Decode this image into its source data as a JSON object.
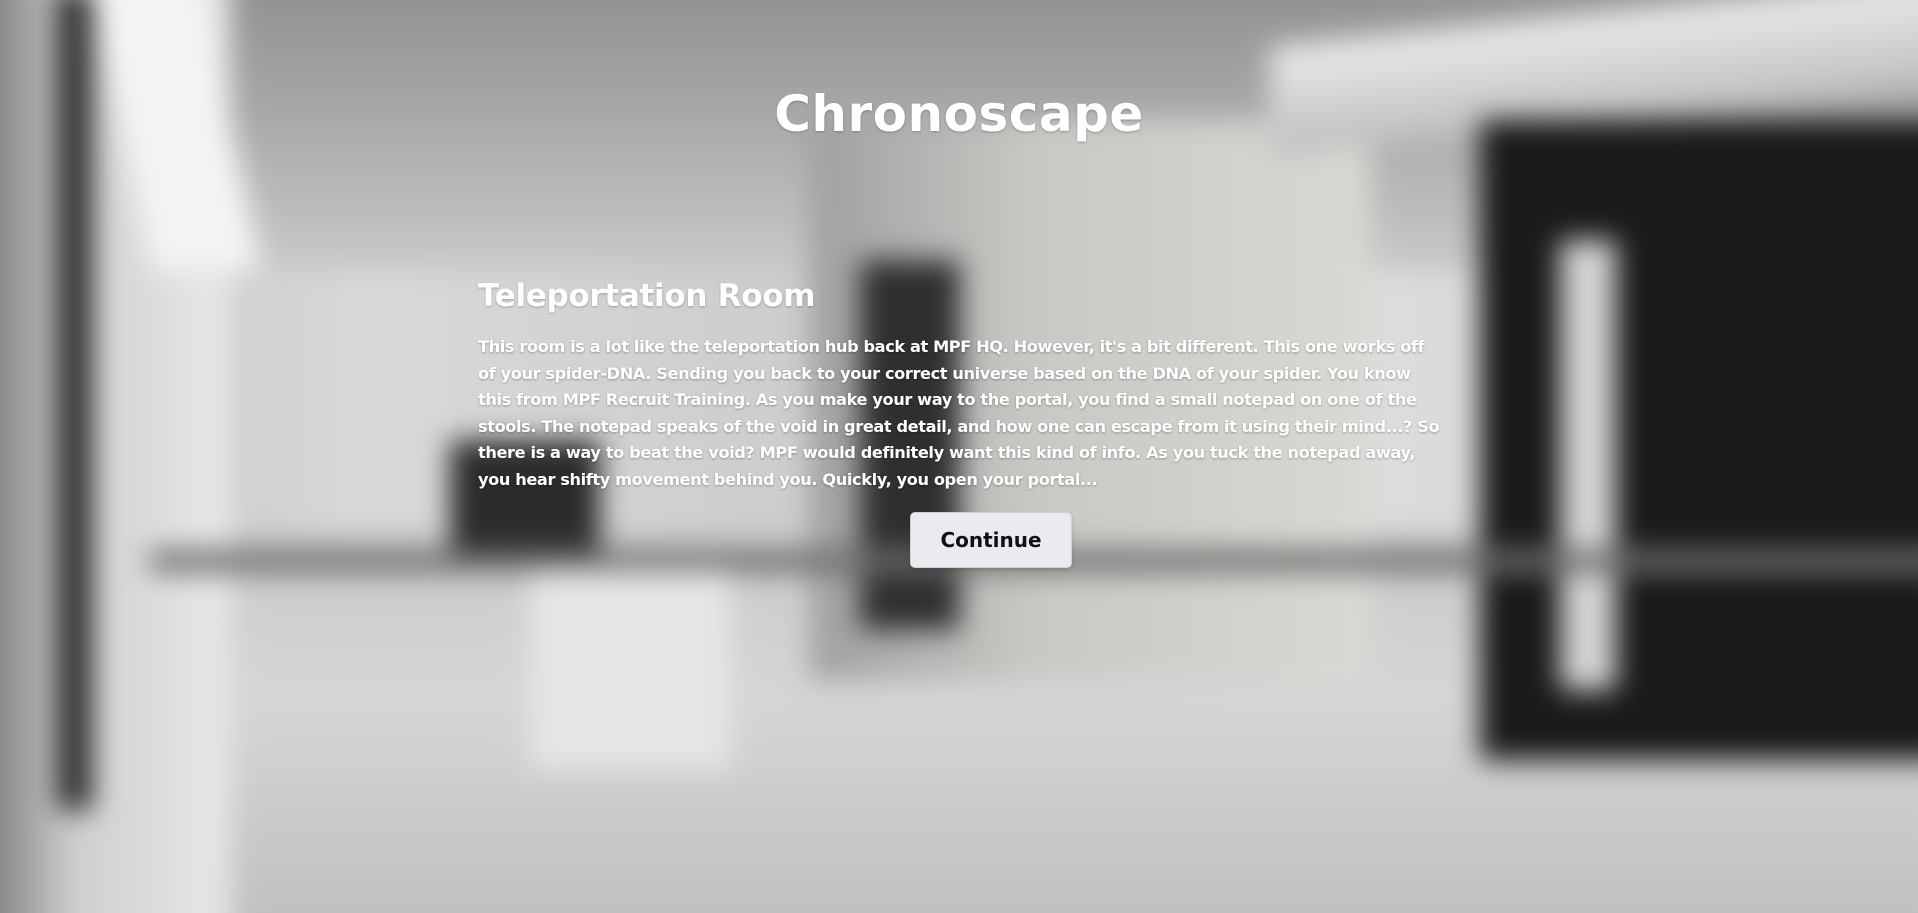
{
  "game": {
    "title": "Chronoscape"
  },
  "room": {
    "title": "Teleportation Room",
    "description": "This room is a lot like the teleportation hub back at MPF HQ. However, it's a bit different. This one works off of your spider-DNA. Sending you back to your correct universe based on the DNA of your spider. You know this from MPF Recruit Training. As you make your way to the portal, you find a small notepad on one of the stools. The notepad speaks of the void in great detail, and how one can escape from it using their mind...? So there is a way to beat the void? MPF would definitely want this kind of info. As you tuck the notepad away, you hear shifty movement behind you. Quickly, you open your portal..."
  },
  "actions": {
    "continue_label": "Continue"
  },
  "colors": {
    "text": "#ffffff",
    "button_bg": "#ebeaf0",
    "button_text": "#111111"
  }
}
